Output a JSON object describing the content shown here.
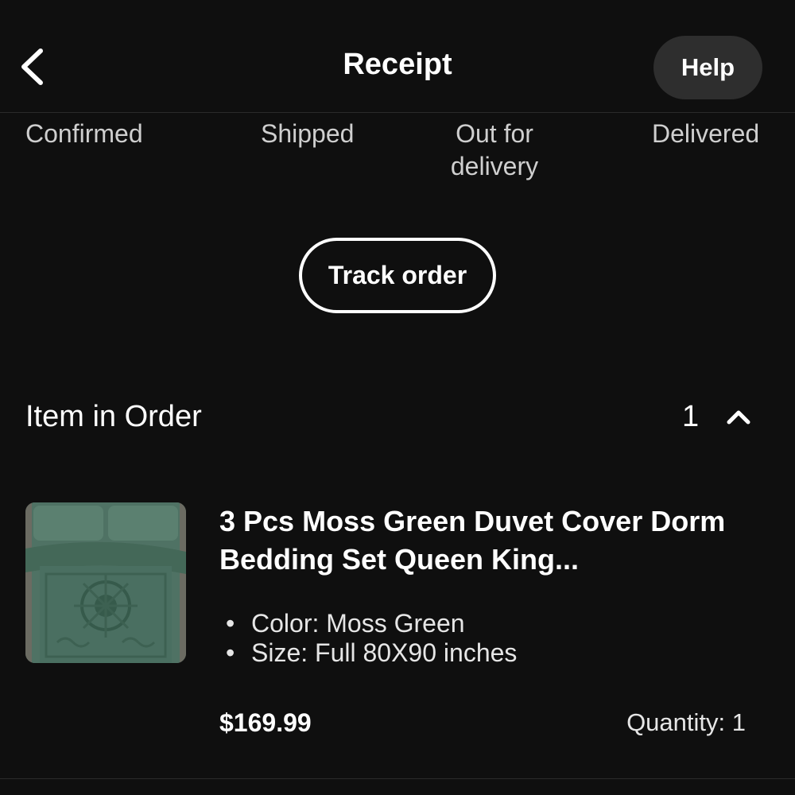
{
  "header": {
    "title": "Receipt",
    "help_label": "Help",
    "back_icon": "chevron-left-icon"
  },
  "status_steps": [
    {
      "label": "Confirmed"
    },
    {
      "label": "Shipped"
    },
    {
      "label": "Out for delivery"
    },
    {
      "label": "Delivered"
    }
  ],
  "track_order_label": "Track order",
  "items_section": {
    "title": "Item in Order",
    "count": "1",
    "toggle_icon": "chevron-up-icon"
  },
  "item": {
    "title": "3 Pcs Moss Green Duvet Cover Dorm Bedding Set Queen King...",
    "attributes": [
      "Color: Moss Green",
      "Size: Full 80X90 inches"
    ],
    "price": "$169.99",
    "quantity_label": "Quantity:",
    "quantity_value": "1",
    "image_icon": "product-thumbnail"
  },
  "colors": {
    "background": "#0f0f0f",
    "help_bg": "#2e2e2e",
    "thumbnail_green": "#4a6a5c"
  }
}
